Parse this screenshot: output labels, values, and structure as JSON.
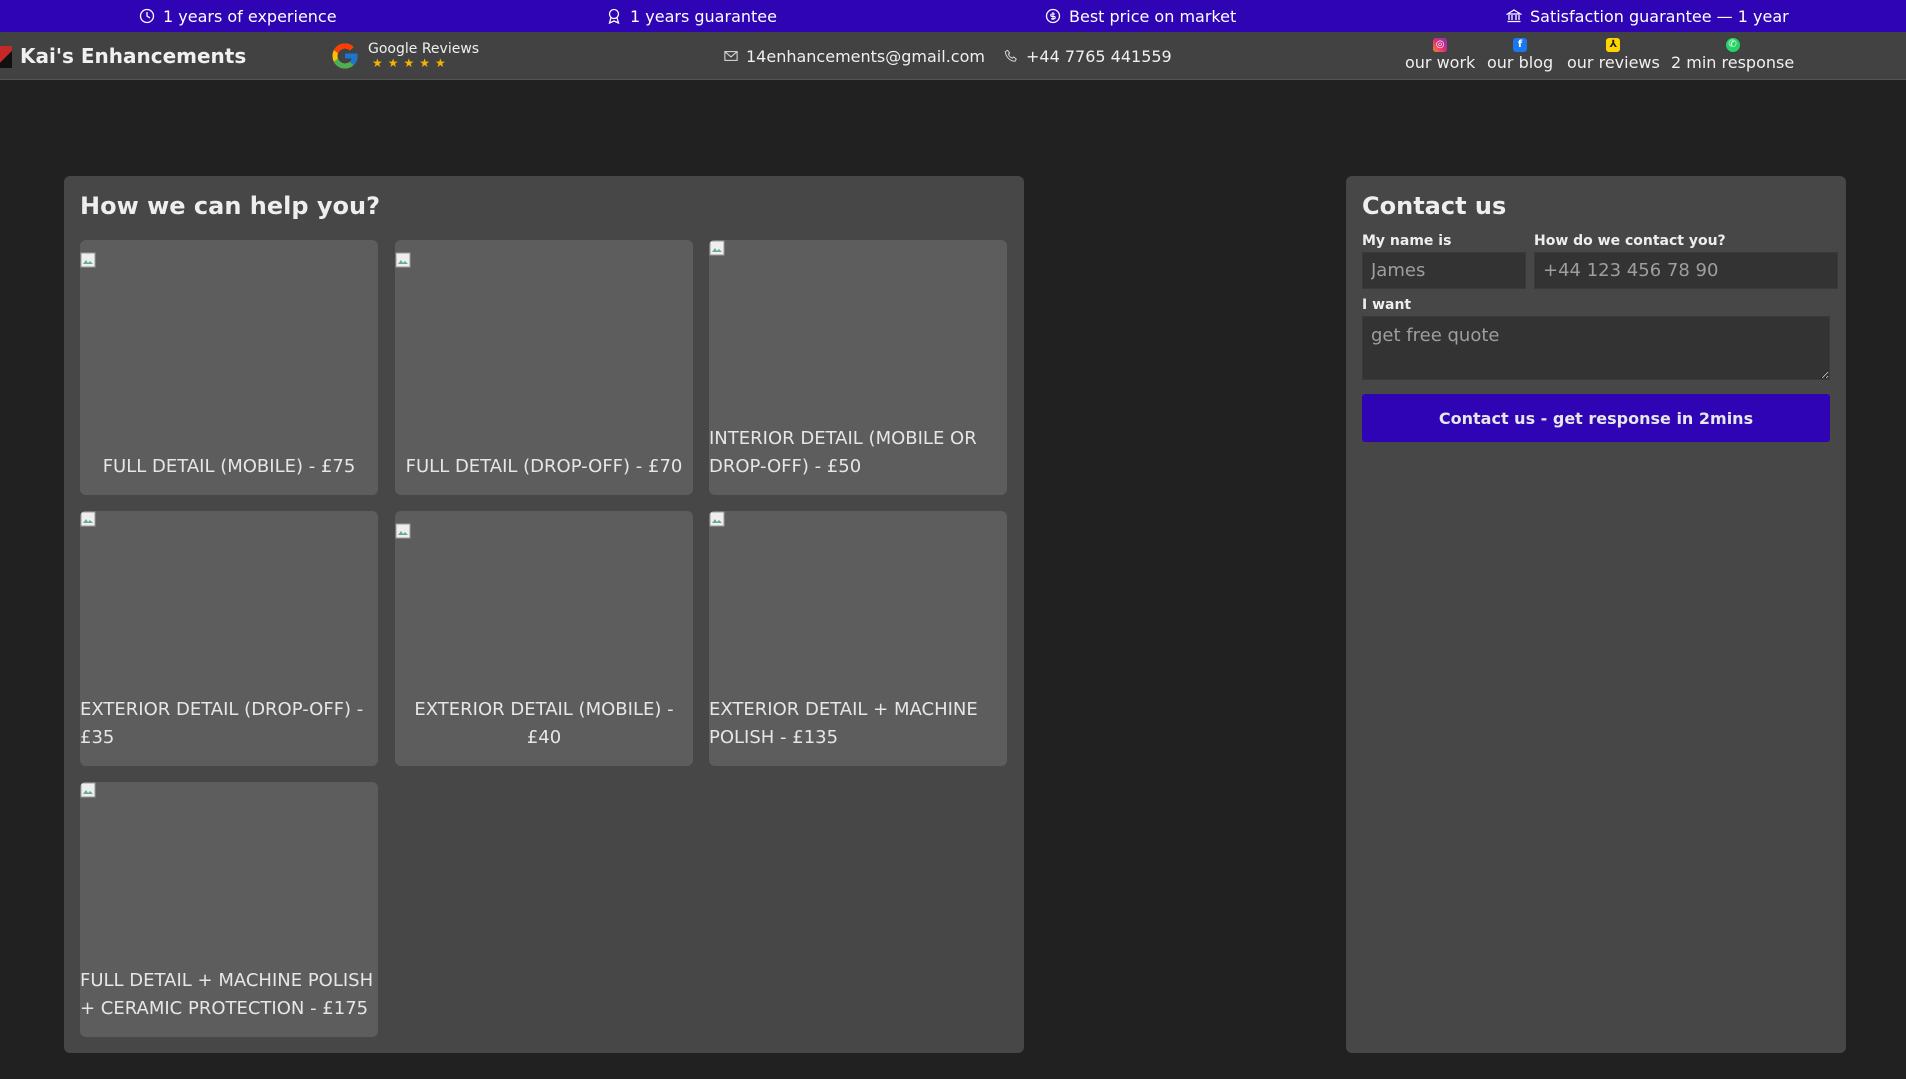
{
  "topbar": {
    "benefits": [
      {
        "icon": "clock-icon",
        "text": "1 years of experience"
      },
      {
        "icon": "award-icon",
        "text": "1 years guarantee"
      },
      {
        "icon": "coin-icon",
        "text": "Best price on market"
      },
      {
        "icon": "bank-icon",
        "text": "Satisfaction guarantee — 1 year"
      }
    ]
  },
  "header": {
    "brand": "Kai's Enhancements",
    "reviews": {
      "title": "Google Reviews",
      "stars": "★★★★★"
    },
    "email": "14enhancements@gmail.com",
    "phone": "+44 7765 441559",
    "socials": [
      {
        "icon": "instagram-icon",
        "label": "our work"
      },
      {
        "icon": "facebook-icon",
        "label": "our blog"
      },
      {
        "icon": "yell-icon",
        "label": "our reviews"
      },
      {
        "icon": "whatsapp-icon",
        "label": "2 min response"
      }
    ]
  },
  "services": {
    "title": "How we can help you?",
    "items": [
      {
        "label": "FULL DETAIL (MOBILE) - £75"
      },
      {
        "label": "FULL DETAIL (DROP-OFF) - £70"
      },
      {
        "label": "INTERIOR DETAIL (MOBILE OR DROP-OFF) - £50"
      },
      {
        "label": "EXTERIOR DETAIL (DROP-OFF) - £35"
      },
      {
        "label": "EXTERIOR DETAIL (MOBILE) - £40"
      },
      {
        "label": "EXTERIOR DETAIL + MACHINE POLISH - £135"
      },
      {
        "label": "FULL DETAIL + MACHINE POLISH + CERAMIC PROTECTION - £175"
      }
    ]
  },
  "contact": {
    "title": "Contact us",
    "name_label": "My name is",
    "name_placeholder": "James",
    "method_label": "How do we contact you?",
    "method_placeholder": "+44 123 456 78 90",
    "want_label": "I want",
    "want_placeholder": "get free quote",
    "submit_label": "Contact us - get response in 2mins"
  },
  "colors": {
    "accent": "#2f04b4",
    "background": "#212121",
    "header": "#424242",
    "panel": "#474747",
    "card": "#5d5d5d",
    "stars": "#f6b400"
  }
}
